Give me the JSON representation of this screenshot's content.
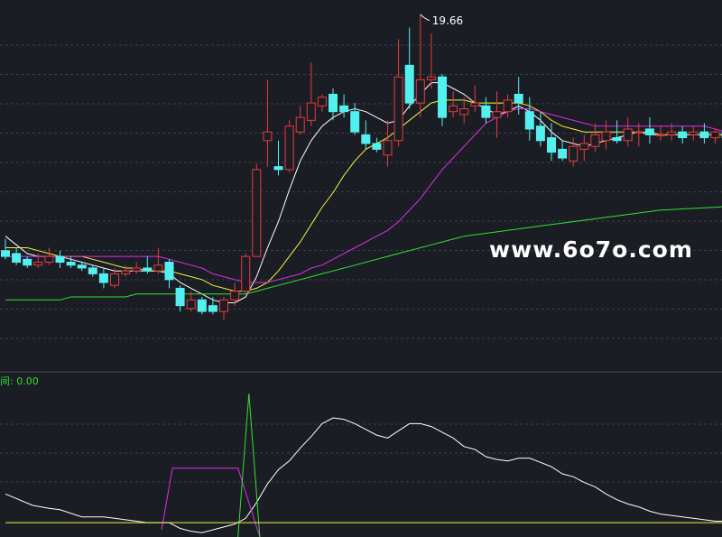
{
  "colors": {
    "background": "#1b1d24",
    "grid": "#3a3f4a",
    "up_candle": "#e83b3b",
    "down_candle": "#54f0f0",
    "ma_white": "#ffffff",
    "ma_yellow": "#f2f23a",
    "ma_magenta": "#dc2ee6",
    "ma_green": "#33e033",
    "indicator_white": "#ffffff",
    "indicator_magenta": "#dc2ee6",
    "indicator_green": "#33e033",
    "indicator_yellow": "#f2f23a",
    "watermark": "#ffffff"
  },
  "watermark": "www.6o7o.com",
  "indicator_header": "间: 0.00",
  "chart_data": [
    {
      "type": "candlestick",
      "title": "",
      "ylim": [
        8.0,
        20.0
      ],
      "grid": "horizontal dashed",
      "high_annotation": "19.66",
      "candles": [
        [
          11.5,
          11.3,
          11.9,
          11.2
        ],
        [
          11.4,
          11.1,
          11.6,
          11.0
        ],
        [
          11.2,
          11.0,
          11.3,
          10.9
        ],
        [
          11.0,
          11.1,
          11.4,
          10.9
        ],
        [
          11.1,
          11.3,
          11.6,
          11.0
        ],
        [
          11.3,
          11.1,
          11.5,
          10.9
        ],
        [
          11.1,
          11.0,
          11.3,
          10.9
        ],
        [
          11.0,
          10.9,
          11.1,
          10.8
        ],
        [
          10.9,
          10.7,
          11.0,
          10.6
        ],
        [
          10.7,
          10.4,
          10.9,
          10.2
        ],
        [
          10.3,
          10.7,
          10.9,
          10.2
        ],
        [
          10.7,
          10.8,
          11.0,
          10.6
        ],
        [
          10.8,
          10.9,
          11.1,
          10.7
        ],
        [
          10.9,
          10.8,
          11.3,
          10.7
        ],
        [
          10.8,
          11.0,
          11.6,
          10.7
        ],
        [
          11.1,
          10.5,
          11.2,
          10.2
        ],
        [
          10.2,
          9.6,
          10.3,
          9.4
        ],
        [
          9.5,
          9.8,
          10.1,
          9.4
        ],
        [
          9.8,
          9.4,
          9.9,
          9.3
        ],
        [
          9.6,
          9.4,
          9.9,
          9.3
        ],
        [
          9.4,
          9.8,
          9.9,
          9.1
        ],
        [
          9.8,
          10.1,
          10.4,
          9.6
        ],
        [
          10.1,
          11.3,
          11.4,
          10.0
        ],
        [
          11.3,
          14.3,
          14.5,
          11.3
        ],
        [
          15.3,
          15.6,
          17.4,
          14.4
        ],
        [
          14.4,
          14.3,
          15.3,
          14.1
        ],
        [
          14.3,
          15.8,
          16.0,
          14.2
        ],
        [
          15.6,
          16.1,
          16.5,
          15.5
        ],
        [
          16.0,
          16.6,
          18.0,
          15.8
        ],
        [
          16.5,
          16.8,
          16.9,
          16.3
        ],
        [
          16.9,
          16.3,
          17.1,
          16.0
        ],
        [
          16.5,
          16.3,
          16.9,
          16.1
        ],
        [
          16.3,
          15.6,
          16.6,
          15.5
        ],
        [
          15.5,
          15.2,
          16.0,
          15.0
        ],
        [
          15.2,
          15.0,
          15.4,
          14.9
        ],
        [
          14.8,
          15.3,
          16.0,
          14.4
        ],
        [
          15.3,
          17.5,
          18.8,
          15.1
        ],
        [
          17.9,
          16.6,
          19.2,
          16.4
        ],
        [
          16.6,
          17.4,
          19.66,
          16.1
        ],
        [
          17.4,
          17.5,
          19.0,
          17.1
        ],
        [
          17.5,
          16.1,
          17.6,
          15.8
        ],
        [
          16.3,
          16.5,
          17.0,
          16.1
        ],
        [
          16.2,
          16.4,
          16.8,
          15.9
        ],
        [
          16.5,
          16.6,
          17.2,
          16.3
        ],
        [
          16.5,
          16.1,
          16.8,
          15.9
        ],
        [
          16.1,
          16.3,
          17.0,
          15.4
        ],
        [
          16.3,
          16.7,
          16.9,
          16.1
        ],
        [
          16.9,
          16.6,
          17.5,
          16.2
        ],
        [
          16.3,
          15.7,
          16.8,
          15.3
        ],
        [
          15.8,
          15.3,
          16.3,
          15.1
        ],
        [
          15.4,
          14.9,
          15.9,
          14.6
        ],
        [
          15.0,
          14.7,
          15.3,
          14.6
        ],
        [
          14.6,
          15.1,
          15.4,
          14.4
        ],
        [
          15.0,
          15.2,
          15.5,
          14.6
        ],
        [
          15.1,
          15.5,
          15.9,
          14.9
        ],
        [
          15.3,
          15.6,
          16.0,
          15.0
        ],
        [
          15.4,
          15.3,
          16.0,
          15.2
        ],
        [
          15.3,
          15.7,
          16.1,
          15.1
        ],
        [
          15.6,
          15.6,
          15.9,
          15.1
        ],
        [
          15.7,
          15.5,
          16.1,
          15.2
        ],
        [
          15.5,
          15.5,
          15.8,
          15.3
        ],
        [
          15.5,
          15.6,
          15.9,
          15.3
        ],
        [
          15.6,
          15.4,
          15.8,
          15.2
        ],
        [
          15.5,
          15.6,
          15.8,
          15.3
        ],
        [
          15.6,
          15.4,
          15.9,
          15.2
        ],
        [
          15.4,
          15.6,
          15.7,
          15.2
        ],
        [
          15.6,
          15.4,
          15.8,
          15.2
        ]
      ],
      "series": [
        {
          "color": "ma_white",
          "values": [
            12.0,
            11.7,
            11.4,
            11.3,
            11.3,
            11.3,
            11.2,
            11.1,
            11.0,
            10.9,
            10.8,
            10.8,
            10.8,
            10.8,
            10.8,
            10.7,
            10.4,
            10.2,
            10.0,
            9.8,
            9.7,
            9.7,
            9.9,
            10.6,
            11.6,
            12.5,
            13.6,
            14.6,
            15.3,
            15.8,
            16.1,
            16.3,
            16.4,
            16.3,
            16.1,
            15.9,
            16.0,
            16.5,
            16.9,
            17.3,
            17.3,
            17.1,
            16.9,
            16.6,
            16.4,
            16.2,
            16.3,
            16.5,
            16.3,
            16.0,
            15.6,
            15.3,
            15.2,
            15.1,
            15.2,
            15.3,
            15.4,
            15.5,
            15.6,
            15.5,
            15.5,
            15.5,
            15.5,
            15.5,
            15.5,
            15.5,
            15.5
          ]
        },
        {
          "color": "ma_yellow",
          "values": [
            11.6,
            11.6,
            11.6,
            11.5,
            11.4,
            11.3,
            11.3,
            11.3,
            11.2,
            11.1,
            11.0,
            10.9,
            10.9,
            10.8,
            10.8,
            10.8,
            10.7,
            10.6,
            10.5,
            10.3,
            10.2,
            10.1,
            10.1,
            10.2,
            10.4,
            10.8,
            11.3,
            11.8,
            12.4,
            13.0,
            13.5,
            14.1,
            14.6,
            15.0,
            15.2,
            15.4,
            15.7,
            16.0,
            16.3,
            16.6,
            16.7,
            16.7,
            16.7,
            16.6,
            16.6,
            16.6,
            16.6,
            16.6,
            16.5,
            16.3,
            16.0,
            15.8,
            15.7,
            15.6,
            15.6,
            15.6,
            15.6,
            15.6,
            15.6,
            15.6,
            15.5,
            15.5,
            15.5,
            15.5,
            15.5,
            15.5,
            15.5
          ]
        },
        {
          "color": "ma_magenta",
          "values": [
            11.3,
            11.3,
            11.3,
            11.3,
            11.3,
            11.3,
            11.3,
            11.3,
            11.3,
            11.3,
            11.3,
            11.3,
            11.3,
            11.3,
            11.3,
            11.2,
            11.1,
            11.0,
            10.9,
            10.7,
            10.6,
            10.5,
            10.4,
            10.4,
            10.4,
            10.5,
            10.6,
            10.7,
            10.9,
            11.0,
            11.2,
            11.4,
            11.6,
            11.8,
            12.0,
            12.2,
            12.5,
            12.9,
            13.3,
            13.8,
            14.3,
            14.7,
            15.1,
            15.5,
            15.9,
            16.1,
            16.3,
            16.4,
            16.4,
            16.3,
            16.2,
            16.1,
            16.0,
            15.9,
            15.8,
            15.8,
            15.8,
            15.8,
            15.8,
            15.8,
            15.8,
            15.8,
            15.8,
            15.8,
            15.8,
            15.7,
            15.6
          ]
        },
        {
          "color": "ma_green",
          "values": [
            9.8,
            9.8,
            9.8,
            9.8,
            9.8,
            9.8,
            9.9,
            9.9,
            9.9,
            9.9,
            9.9,
            9.9,
            10.0,
            10.0,
            10.0,
            10.0,
            10.0,
            10.0,
            10.0,
            10.0,
            10.0,
            10.0,
            10.0,
            10.1,
            10.2,
            10.3,
            10.4,
            10.5,
            10.6,
            10.7,
            10.8,
            10.9,
            11.0,
            11.1,
            11.2,
            11.3,
            11.4,
            11.5,
            11.6,
            11.7,
            11.8,
            11.9,
            12.0,
            12.05,
            12.1,
            12.15,
            12.2,
            12.25,
            12.3,
            12.35,
            12.4,
            12.45,
            12.5,
            12.55,
            12.6,
            12.65,
            12.7,
            12.75,
            12.8,
            12.85,
            12.9,
            12.92,
            12.94,
            12.96,
            12.98,
            13.0,
            13.02
          ]
        }
      ]
    },
    {
      "type": "line",
      "title": "",
      "ylim": [
        0,
        100
      ],
      "series": [
        {
          "color": "indicator_white",
          "points": [
            [
              0,
              30
            ],
            [
              2.5,
              22
            ],
            [
              4,
              20
            ],
            [
              5,
              19
            ],
            [
              7,
              14
            ],
            [
              9,
              14
            ],
            [
              11,
              12
            ],
            [
              13,
              10
            ],
            [
              15,
              10
            ],
            [
              16,
              6
            ],
            [
              17,
              4
            ],
            [
              18,
              3
            ],
            [
              20,
              7
            ],
            [
              21,
              9
            ],
            [
              22,
              13
            ],
            [
              23,
              24
            ],
            [
              24,
              37
            ],
            [
              25,
              47
            ],
            [
              26,
              53
            ],
            [
              27,
              62
            ],
            [
              28,
              70
            ],
            [
              29,
              79
            ],
            [
              30,
              83
            ],
            [
              31,
              82
            ],
            [
              32,
              79
            ],
            [
              33,
              75
            ],
            [
              34,
              71
            ],
            [
              35,
              69
            ],
            [
              36,
              74
            ],
            [
              37,
              79
            ],
            [
              38,
              79
            ],
            [
              39,
              77
            ],
            [
              40,
              73
            ],
            [
              41,
              69
            ],
            [
              42,
              63
            ],
            [
              43,
              61
            ],
            [
              44,
              56
            ],
            [
              45,
              54
            ],
            [
              46,
              53
            ],
            [
              47,
              55
            ],
            [
              48,
              55
            ],
            [
              49,
              52
            ],
            [
              50,
              49
            ],
            [
              51,
              44
            ],
            [
              52,
              42
            ],
            [
              53,
              38
            ],
            [
              54,
              35
            ],
            [
              55,
              30
            ],
            [
              56,
              26
            ],
            [
              57,
              23
            ],
            [
              58,
              21
            ],
            [
              59,
              18
            ],
            [
              60,
              16
            ],
            [
              61,
              15
            ],
            [
              62,
              14
            ],
            [
              63,
              13
            ],
            [
              64,
              12
            ],
            [
              65,
              11
            ],
            [
              66,
              11
            ]
          ]
        },
        {
          "color": "indicator_magenta",
          "points": [
            [
              14.3,
              5
            ],
            [
              15.3,
              48
            ],
            [
              16.3,
              48
            ],
            [
              17.3,
              48
            ],
            [
              18.3,
              48
            ],
            [
              19.3,
              48
            ],
            [
              20.3,
              48
            ],
            [
              21.3,
              48
            ],
            [
              23.3,
              0
            ]
          ]
        },
        {
          "color": "indicator_green",
          "points": [
            [
              21.3,
              0
            ],
            [
              22.3,
              100
            ],
            [
              23.3,
              0
            ]
          ]
        },
        {
          "color": "indicator_yellow",
          "points": [
            [
              0,
              10
            ],
            [
              66,
              10
            ]
          ]
        }
      ]
    }
  ]
}
